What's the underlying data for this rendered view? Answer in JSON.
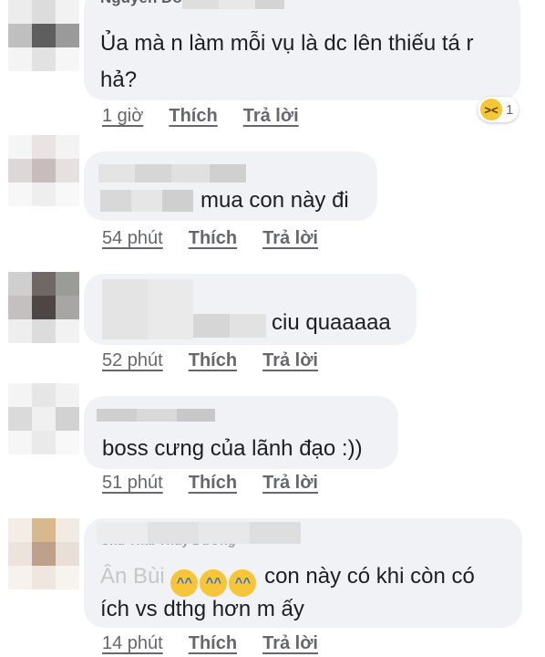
{
  "comments": [
    {
      "author": "Nguyễn Đô",
      "text_line1": "Ủa mà n làm mỗi vụ là dc lên thiếu tá r",
      "text_line2": "hả?",
      "time": "1 giờ",
      "like": "Thích",
      "reply": "Trả lời",
      "reaction": {
        "icon": "laughing-emoji-icon",
        "count": "1"
      }
    },
    {
      "text": "mua con này đi",
      "time": "54 phút",
      "like": "Thích",
      "reply": "Trả lời"
    },
    {
      "text": "ciu quaaaaa",
      "time": "52 phút",
      "like": "Thích",
      "reply": "Trả lời"
    },
    {
      "text": "boss cưng của lãnh đạo :))",
      "time": "51 phút",
      "like": "Thích",
      "reply": "Trả lời"
    },
    {
      "author": "Chu Thái Thùy Dương",
      "mention": "Ân Bùi",
      "emojis": [
        "tears-of-joy-emoji-icon",
        "tears-of-joy-emoji-icon",
        "tears-of-joy-emoji-icon"
      ],
      "text_line1": "con này có khi còn có",
      "text_line2": "ích vs dthg hơn m ấy",
      "time": "14 phút",
      "like": "Thích",
      "reply": "Trả lời"
    }
  ],
  "colors": {
    "bubble": "#f0f2f5",
    "meta_text": "#65676b",
    "body_text": "#1c1e21",
    "emoji": "#f7c538"
  }
}
